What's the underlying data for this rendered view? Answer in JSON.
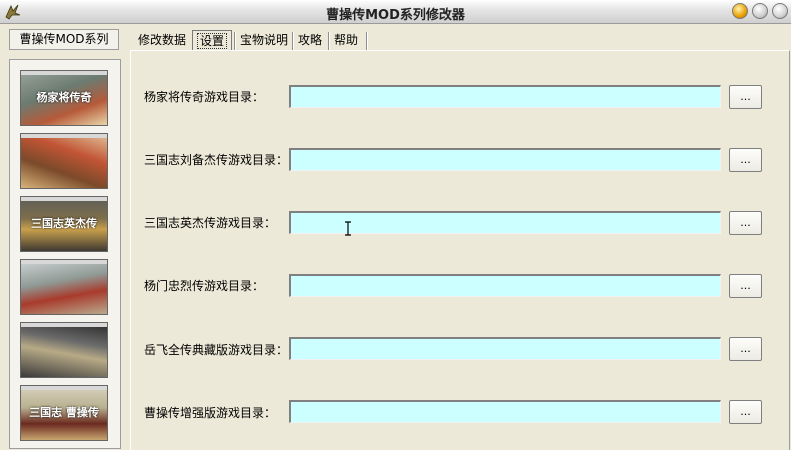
{
  "window": {
    "title": "曹操传MOD系列修改器"
  },
  "left_panel": {
    "header": "曹操传MOD系列",
    "thumbnails": [
      {
        "label": "杨家将传奇"
      },
      {
        "label": ""
      },
      {
        "label": "三国志英杰传"
      },
      {
        "label": ""
      },
      {
        "label": ""
      },
      {
        "label": "三国志 曹操传"
      }
    ]
  },
  "tabs": [
    {
      "label": "修改数据"
    },
    {
      "label": "设置"
    },
    {
      "label": "宝物说明"
    },
    {
      "label": "攻略"
    },
    {
      "label": "帮助"
    }
  ],
  "active_tab": "设置",
  "rows": [
    {
      "label": "杨家将传奇游戏目录：",
      "value": "",
      "button": "..."
    },
    {
      "label": "三国志刘备杰传游戏目录：",
      "value": "",
      "button": "..."
    },
    {
      "label": "三国志英杰传游戏目录：",
      "value": "",
      "button": "..."
    },
    {
      "label": "杨门忠烈传游戏目录：",
      "value": "",
      "button": "..."
    },
    {
      "label": "岳飞全传典藏版游戏目录：",
      "value": "",
      "button": "..."
    },
    {
      "label": "曹操传增强版游戏目录：",
      "value": "",
      "button": "..."
    }
  ],
  "colors": {
    "input_bg": "#ccffff",
    "window_bg": "#ece9d8"
  }
}
